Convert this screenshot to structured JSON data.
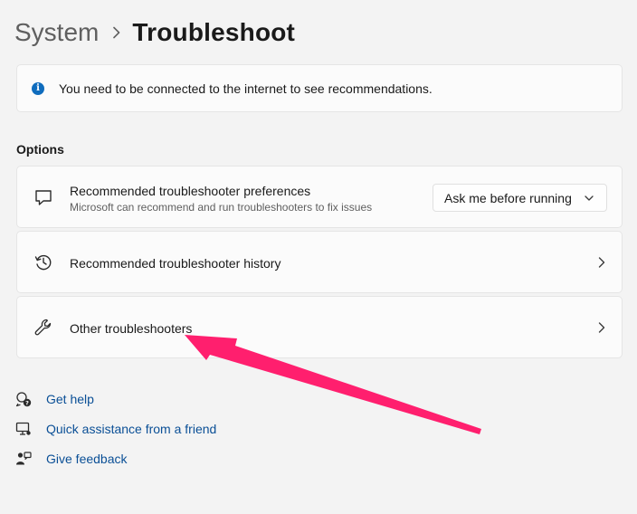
{
  "breadcrumb": {
    "parent": "System",
    "current": "Troubleshoot"
  },
  "info": {
    "icon": "info-icon",
    "text": "You need to be connected to the internet to see recommendations."
  },
  "options": {
    "label": "Options",
    "items": [
      {
        "icon": "chat-bubble-icon",
        "title": "Recommended troubleshooter preferences",
        "description": "Microsoft can recommend and run troubleshooters to fix issues",
        "dropdown_value": "Ask me before running"
      },
      {
        "icon": "history-icon",
        "title": "Recommended troubleshooter history"
      },
      {
        "icon": "wrench-icon",
        "title": "Other troubleshooters"
      }
    ]
  },
  "links": [
    {
      "icon": "help-icon",
      "label": "Get help"
    },
    {
      "icon": "quick-assist-icon",
      "label": "Quick assistance from a friend"
    },
    {
      "icon": "feedback-icon",
      "label": "Give feedback"
    }
  ],
  "colors": {
    "accent": "#0f6cbd",
    "link": "#0a4f96",
    "annotation_arrow": "#ff1f6e",
    "background": "#f3f3f3"
  }
}
